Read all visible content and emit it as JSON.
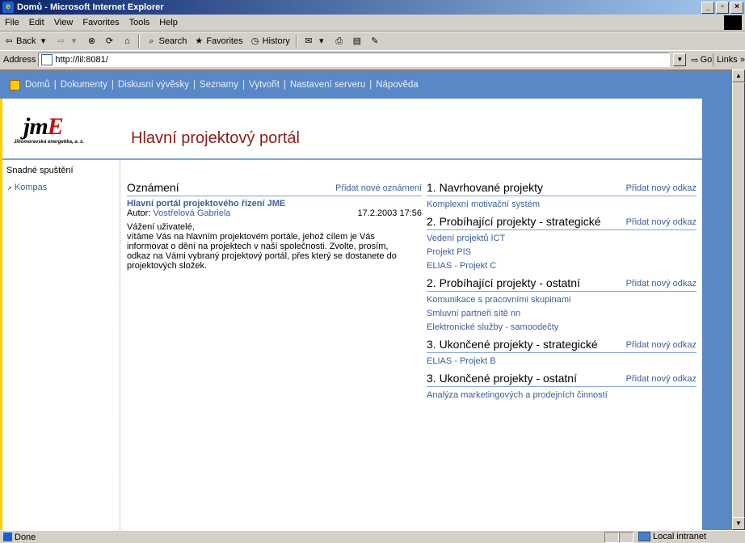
{
  "window": {
    "title": "Domů - Microsoft Internet Explorer",
    "controls": [
      "_",
      "ø",
      "×"
    ]
  },
  "menu": [
    "File",
    "Edit",
    "View",
    "Favorites",
    "Tools",
    "Help"
  ],
  "toolbar": {
    "back": "Back",
    "search": "Search",
    "favorites": "Favorites",
    "history": "History"
  },
  "address": {
    "label": "Address",
    "url": "http://lil:8081/",
    "go": "Go",
    "links": "Links"
  },
  "nav": {
    "items": [
      "Domů",
      "Dokumenty",
      "Diskusní vývěsky",
      "Seznamy",
      "Vytvořit",
      "Nastavení serveru",
      "Nápověda"
    ],
    "separator": "|"
  },
  "logo": {
    "jm": "jm",
    "e": "E",
    "subtitle": "Jihomoravská energetika, a. s."
  },
  "site_title": "Hlavní projektový portál",
  "sidebar": {
    "title": "Snadné spuštění",
    "link": "Kompas"
  },
  "announcements": {
    "title": "Oznámení",
    "add": "Přidat nové oznámení",
    "item_title": "Hlavní portál projektového řízení JME",
    "author_label": "Autor:",
    "author": "Vostřelová Gabriela",
    "date": "17.2.2003 17:56",
    "body": [
      "Vážení uživatelé,",
      "vítáme Vás na hlavním projektovém portále, jehož cílem je Vás",
      "informovat o dění na projektech v naší společnosti. Zvolte, prosím,",
      "odkaz na Vámi vybraný projektový portál, přes který se dostanete do",
      "projektových složek."
    ]
  },
  "projects": [
    {
      "title": "1. Navrhované projekty",
      "add": "Přidat nový odkaz",
      "items": [
        "Komplexní motivační systém"
      ]
    },
    {
      "title": "2. Probíhající projekty - strategické",
      "add": "Přidat nový odkaz",
      "items": [
        "Vedení projektů ICT",
        "Projekt PIS",
        "ELIAS - Projekt C"
      ]
    },
    {
      "title": "2. Probíhající projekty - ostatní",
      "add": "Přidat nový odkaz",
      "items": [
        "Komunikace s pracovními skupinami",
        "Smluvní partneři sítě nn",
        "Elektronické služby - samoodečty"
      ]
    },
    {
      "title": "3. Ukončené projekty - strategické",
      "add": "Přidat nový odkaz",
      "items": [
        "ELIAS - Projekt B"
      ]
    },
    {
      "title": "3. Ukončené projekty - ostatní",
      "add": "Přidat nový odkaz",
      "items": [
        "Analýza marketingových a prodejních činností"
      ]
    }
  ],
  "status": {
    "text": "Done",
    "zone": "Local intranet"
  },
  "colors": {
    "nav_bg": "#5a87c6",
    "link": "#3a5f9a",
    "title": "#8a1c1c",
    "accent_yellow": "#ffcc00"
  }
}
